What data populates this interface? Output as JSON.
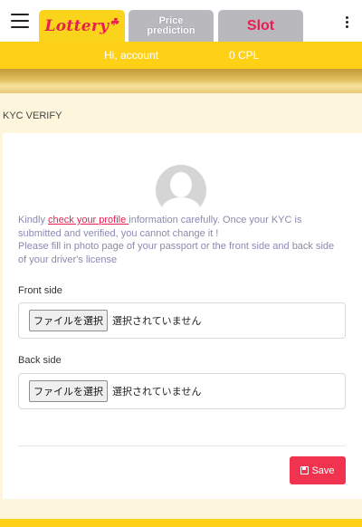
{
  "nav": {
    "tabs": [
      {
        "label": "Lottery",
        "clover": "☘"
      },
      {
        "label": "Price prediction",
        "line1": "Price",
        "line2": "prediction"
      },
      {
        "label": "Slot"
      }
    ]
  },
  "account": {
    "greeting": "Hi, account",
    "balance": "0 CPL"
  },
  "page": {
    "title": "KYC VERIFY"
  },
  "kyc": {
    "instructions_prefix": "Kindly ",
    "instructions_link": "check your profile ",
    "instructions_suffix": "information carefully. Once your KYC is submitted and verified, you cannot change it !",
    "instructions_line2": "Please fill in photo page of your passport or the front side and back side of your driver's license",
    "front_label": "Front side",
    "back_label": "Back side",
    "file_button_label": "ファイルを選択",
    "file_status": "選択されていません",
    "save_label": "Save"
  },
  "colors": {
    "accent_yellow": "#fed116",
    "accent_pink": "#e91e53",
    "save_red": "#f2334f",
    "page_bg": "#fdf5dc"
  }
}
